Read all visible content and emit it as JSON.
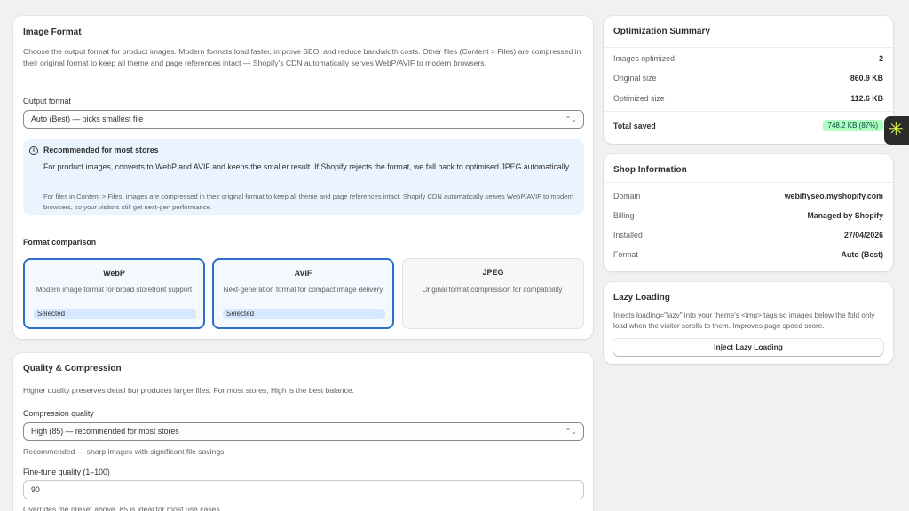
{
  "image_format": {
    "title": "Image Format",
    "description": "Choose the output format for product images. Modern formats load faster, improve SEO, and reduce bandwidth costs. Other files (Content > Files) are compressed in their original format to keep all theme and page references intact — Shopify's CDN automatically serves WebP/AVIF to modern browsers.",
    "output_label": "Output format",
    "output_value": "Auto (Best) — picks smallest file",
    "banner": {
      "icon": "info-icon",
      "title": "Recommended for most stores",
      "main": "For product images, converts to WebP and AVIF and keeps the smaller result. If Shopify rejects the format, we fall back to optimised JPEG automatically.",
      "sub": "For files in Content > Files, images are compressed in their original format to keep all theme and page references intact. Shopify CDN automatically serves WebP/AVIF to modern browsers, so your visitors still get next-gen performance."
    },
    "comparison_title": "Format comparison",
    "formats": [
      {
        "name": "WebP",
        "desc": "Modern image format for broad storefront support",
        "badge": "Selected"
      },
      {
        "name": "AVIF",
        "desc": "Next-generation format for compact image delivery",
        "badge": "Selected"
      },
      {
        "name": "JPEG",
        "desc": "Original format compression for compatibility"
      }
    ]
  },
  "quality": {
    "title": "Quality & Compression",
    "description": "Higher quality preserves detail but produces larger files. For most stores, High is the best balance.",
    "compression_label": "Compression quality",
    "compression_value": "High (85) — recommended for most stores",
    "compression_note": "Recommended — sharp images with significant file savings.",
    "finetune_label": "Fine-tune quality (1–100)",
    "finetune_value": "90",
    "finetune_note": "Overrides the preset above. 85 is ideal for most use cases."
  },
  "summary": {
    "title": "Optimization Summary",
    "rows": [
      {
        "k": "Images optimized",
        "v": "2"
      },
      {
        "k": "Original size",
        "v": "860.9 KB"
      },
      {
        "k": "Optimized size",
        "v": "112.6 KB"
      }
    ],
    "total_label": "Total saved",
    "total_value": "748.2 KB (87%)",
    "accent": "#affebf"
  },
  "shop": {
    "title": "Shop Information",
    "rows": [
      {
        "k": "Domain",
        "v": "webifiyseo.myshopify.com"
      },
      {
        "k": "Billing",
        "v": "Managed by Shopify"
      },
      {
        "k": "Installed",
        "v": "27/04/2026"
      },
      {
        "k": "Format",
        "v": "Auto (Best)"
      }
    ]
  },
  "lazy": {
    "title": "Lazy Loading",
    "description": "Injects loading=\"lazy\" into your theme's <img> tags so images below the fold only load when the visitor scrolls to them. Improves page speed score.",
    "button": "Inject Lazy Loading"
  },
  "fab": {
    "icon": "asterisk-icon",
    "glyph": "✳"
  },
  "select_chevron": "⌃⌄"
}
